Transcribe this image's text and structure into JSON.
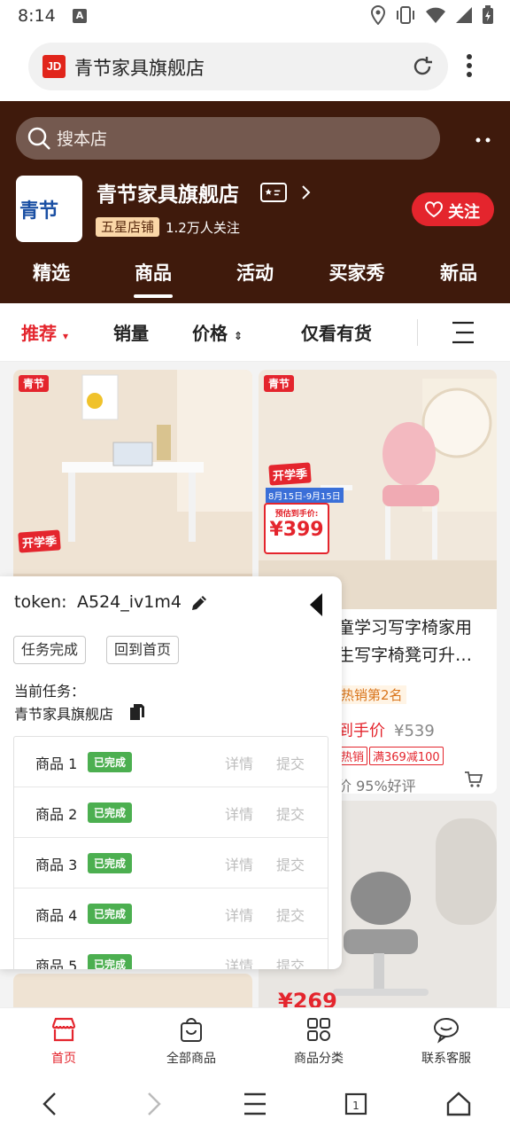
{
  "status_bar": {
    "time": "8:14",
    "badge": "A"
  },
  "browser": {
    "url_title": "青节家具旗舰店",
    "logo_text": "JD"
  },
  "store": {
    "search_placeholder": "搜本店",
    "logo_text": "青节",
    "name": "青节家具旗舰店",
    "level": "五星店铺",
    "fans": "1.2万人关注",
    "follow_label": "关注",
    "tabs": [
      "精选",
      "商品",
      "活动",
      "买家秀",
      "新品"
    ],
    "active_tab": "商品"
  },
  "filter": {
    "recommend": "推荐",
    "sales": "销量",
    "price": "价格",
    "in_stock": "仅看有货"
  },
  "products": [
    {
      "brand_tag": "青节",
      "promo": "开学季"
    },
    {
      "brand_tag": "青节",
      "promo": "开学季",
      "promo_dates": "8月15日-9月15日",
      "promo_price_label": "预估到手价:",
      "promo_price": "399",
      "title_line1": "童学习写字椅家用",
      "title_line2": "生写字椅凳可升…",
      "rank": "热销第2名",
      "price_label": "到手价",
      "orig_price": "¥539",
      "tag1": "热销",
      "tag2": "满369减100",
      "review": "价 95%好评"
    },
    {
      "promo_price": "269"
    }
  ],
  "panel": {
    "token_label": "token:",
    "token_value": "A524_iv1m4",
    "btn_done": "任务完成",
    "btn_home": "回到首页",
    "current_label": "当前任务：",
    "current_value": "青节家具旗舰店",
    "rows": [
      {
        "name": "商品 1",
        "status": "已完成",
        "detail": "详情",
        "submit": "提交"
      },
      {
        "name": "商品 2",
        "status": "已完成",
        "detail": "详情",
        "submit": "提交"
      },
      {
        "name": "商品 3",
        "status": "已完成",
        "detail": "详情",
        "submit": "提交"
      },
      {
        "name": "商品 4",
        "status": "已完成",
        "detail": "详情",
        "submit": "提交"
      },
      {
        "name": "商品 5",
        "status": "已完成",
        "detail": "详情",
        "submit": "提交"
      }
    ]
  },
  "store_nav": [
    {
      "label": "首页",
      "icon": "shop-icon"
    },
    {
      "label": "全部商品",
      "icon": "bag-icon"
    },
    {
      "label": "商品分类",
      "icon": "category-icon"
    },
    {
      "label": "联系客服",
      "icon": "chat-icon"
    }
  ],
  "colors": {
    "brand_red": "#e4252d",
    "header_brown": "#3f1a0c",
    "done_green": "#4caf50"
  }
}
